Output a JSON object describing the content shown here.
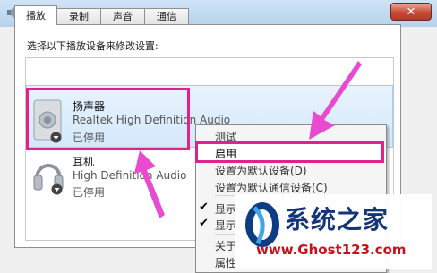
{
  "window": {
    "title": "声音",
    "close_glyph": "✕"
  },
  "tabs": [
    {
      "label": "播放",
      "active": true
    },
    {
      "label": "录制"
    },
    {
      "label": "声音"
    },
    {
      "label": "通信"
    }
  ],
  "instruction": "选择以下播放设备来修改设置:",
  "devices": [
    {
      "name": "扬声器",
      "driver": "Realtek High Definition Audio",
      "state": "已停用"
    },
    {
      "name": "耳机",
      "driver": "High Definition Audio",
      "state": "已停用"
    }
  ],
  "context_menu": {
    "items": [
      {
        "label": "测试"
      },
      {
        "label": "启用"
      },
      {
        "label": "设置为默认设备(D)"
      },
      {
        "label": "设置为默认通信设备(C)"
      },
      {
        "label": "显示",
        "checked": true
      },
      {
        "label": "显示",
        "checked": true
      },
      {
        "label": "关于"
      },
      {
        "label": "属性"
      }
    ]
  },
  "watermark": {
    "title": "系统之家",
    "url": "www.Ghost123.com"
  },
  "colors": {
    "highlight": "#e0238c",
    "arrow": "#e94bd0"
  }
}
